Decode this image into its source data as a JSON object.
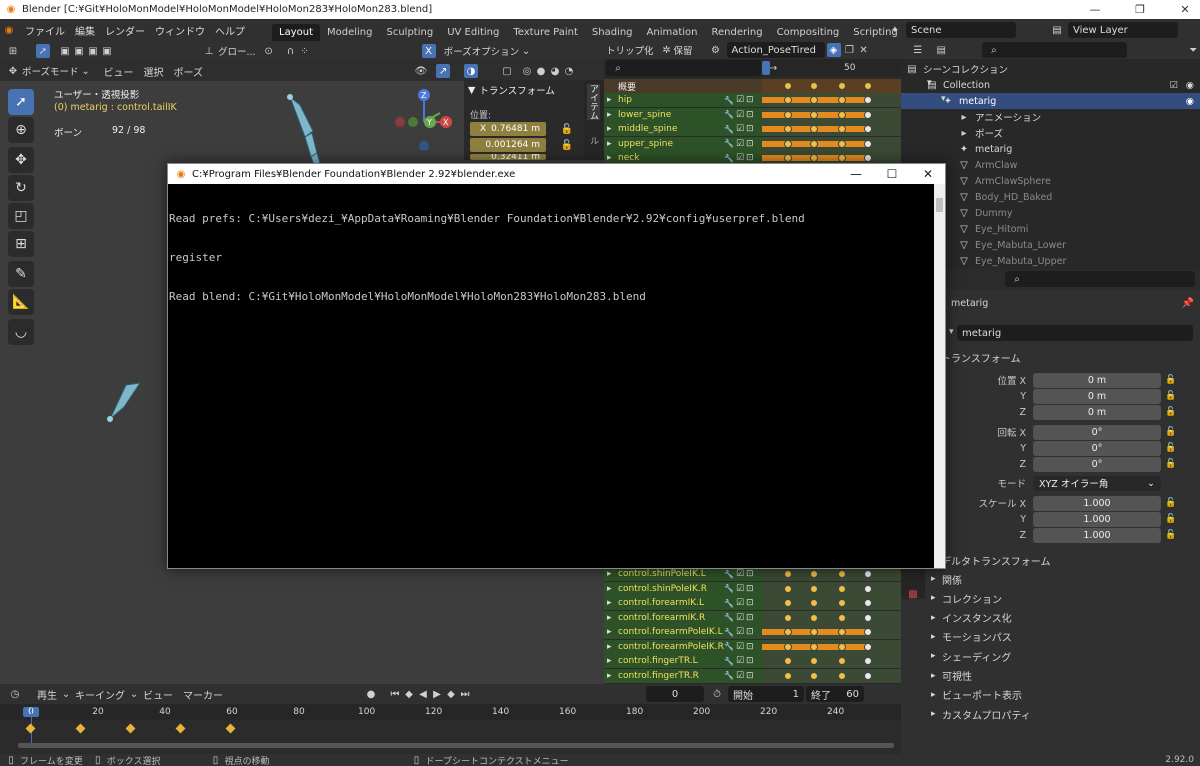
{
  "window": {
    "title": "Blender [C:¥Git¥HoloMonModel¥HoloMonModel¥HoloMon283¥HoloMon283.blend]"
  },
  "topbar": {
    "menus": [
      "ファイル",
      "編集",
      "レンダー",
      "ウィンドウ",
      "ヘルプ"
    ],
    "workspaces": [
      "Layout",
      "Modeling",
      "Sculpting",
      "UV Editing",
      "Texture Paint",
      "Shading",
      "Animation",
      "Rendering",
      "Compositing",
      "Scripting"
    ],
    "active_workspace": "Layout",
    "add_tab": "+",
    "scene": "Scene",
    "view_layer": "View Layer"
  },
  "viewport": {
    "transform_orientation": "グロー...",
    "mode": "ポーズモード",
    "menus": [
      "ビュー",
      "選択",
      "ポーズ"
    ],
    "pose_options": "ポーズオプション",
    "x_mirror": "X",
    "view_label": "ユーザー・透視投影",
    "active_bone": "(0) metarig : control.tailIK",
    "bone_count_label": "ボーン",
    "bone_count": "92 / 98",
    "gizmo_labels": {
      "x": "X",
      "y": "Y",
      "z": "Z"
    },
    "tools": [
      "select-tool",
      "cursor-tool",
      "move-tool",
      "rotate-tool",
      "scale-tool",
      "transform-tool",
      "annotate-tool",
      "measure-tool",
      "pose-relax-tool"
    ]
  },
  "npanel": {
    "header": "トランスフォーム",
    "location_label": "位置:",
    "values": [
      "0.76481 m",
      "0.001264 m",
      "0.32411 m"
    ],
    "axis_label": "X",
    "tabs": [
      "アイテム",
      "ツール"
    ]
  },
  "dopesheet": {
    "header_buttons": [
      "トリップ化",
      "保留"
    ],
    "action_name": "Action_PoseTired",
    "frame_marker": "50",
    "summary": "概要",
    "channels_top": [
      "hip",
      "lower_spine",
      "middle_spine",
      "upper_spine",
      "neck"
    ],
    "channels_bottom": [
      "control.shinPoleIK.L",
      "control.shinPoleIK.R",
      "control.forearmIK.L",
      "control.forearmIK.R",
      "control.forearmPoleIK.L",
      "control.forearmPoleIK.R",
      "control.fingerTR.L",
      "control.fingerTR.R"
    ]
  },
  "outliner": {
    "scene_collection": "シーンコレクション",
    "collection": "Collection",
    "metarig": "metarig",
    "animation": "アニメーション",
    "pose": "ポーズ",
    "armature_data": "metarig",
    "objects": [
      "ArmClaw",
      "ArmClawSphere",
      "Body_HD_Baked",
      "Dummy",
      "Eye_Hitomi",
      "Eye_Mabuta_Lower",
      "Eye_Mabuta_Upper"
    ]
  },
  "properties": {
    "object_name": "metarig",
    "name_field": "metarig",
    "transform_header": "トランスフォーム",
    "location": {
      "label": "位置 X",
      "y_label": "Y",
      "z_label": "Z",
      "x": "0 m",
      "y": "0 m",
      "z": "0 m"
    },
    "rotation": {
      "label": "回転 X",
      "y_label": "Y",
      "z_label": "Z",
      "x": "0°",
      "y": "0°",
      "z": "0°"
    },
    "mode_label": "モード",
    "rotation_mode": "XYZ オイラー角",
    "scale": {
      "label": "スケール X",
      "y_label": "Y",
      "z_label": "Z",
      "x": "1.000",
      "y": "1.000",
      "z": "1.000"
    },
    "delta_transform": "デルタトランスフォーム",
    "sections": [
      "関係",
      "コレクション",
      "インスタンス化",
      "モーションパス",
      "シェーディング",
      "可視性",
      "ビューポート表示",
      "カスタムプロパティ"
    ]
  },
  "timeline": {
    "menus": [
      "再生",
      "キーイング",
      "ビュー",
      "マーカー"
    ],
    "current_frame": "0",
    "start_label": "開始",
    "start": "1",
    "end_label": "終了",
    "end": "60",
    "ruler": [
      "0",
      "20",
      "40",
      "60",
      "80",
      "100",
      "120",
      "140",
      "160",
      "180",
      "200",
      "220",
      "240"
    ]
  },
  "statusbar": {
    "items": [
      "フレームを変更",
      "ボックス選択",
      "視点の移動",
      "ドープシートコンテクストメニュー"
    ],
    "version": "2.92.0"
  },
  "console": {
    "title": "C:¥Program Files¥Blender Foundation¥Blender 2.92¥blender.exe",
    "lines": [
      "Read prefs: C:¥Users¥dezi_¥AppData¥Roaming¥Blender Foundation¥Blender¥2.92¥config¥userpref.blend",
      "register",
      "Read blend: C:¥Git¥HoloMonModel¥HoloMonModel¥HoloMon283¥HoloMon283.blend"
    ]
  },
  "colors": {
    "accent": "#4772b3",
    "keyframe_bar": "#e38b1e",
    "channel_green": "#2e5227",
    "channel_text": "#f0e060"
  }
}
